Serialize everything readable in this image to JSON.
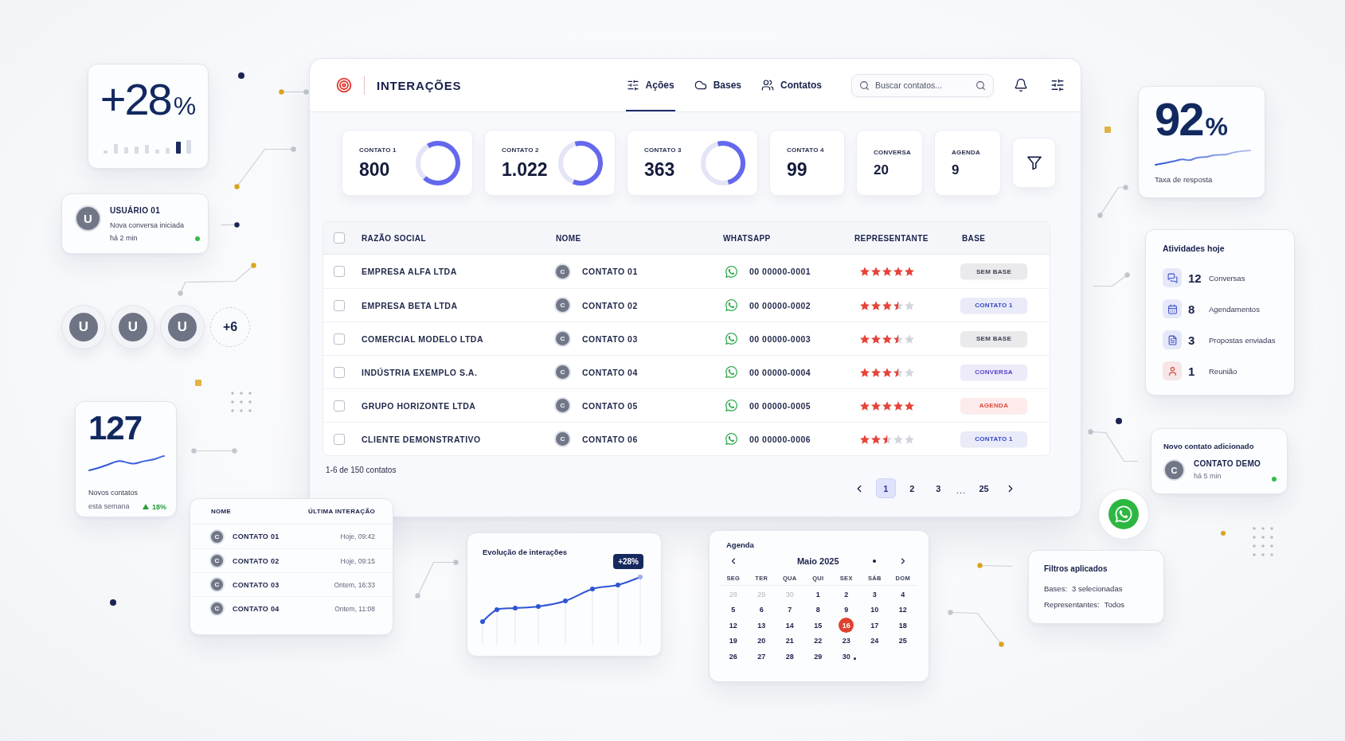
{
  "growth_card": {
    "value": "+28",
    "unit": "%"
  },
  "user_card": {
    "avatar": "U",
    "name": "USUÁRIO 01",
    "message": "Nova conversa iniciada",
    "time": "há 2 min",
    "online": true
  },
  "avatar_group": {
    "avatars": [
      "U",
      "U",
      "U"
    ],
    "more": "+6"
  },
  "new_contacts_card": {
    "value": "127",
    "label": "Novos contatos",
    "period": "esta semana",
    "change": "18%"
  },
  "header": {
    "title": "INTERAÇÕES",
    "tabs": [
      {
        "label": "Ações",
        "selected": true
      },
      {
        "label": "Bases",
        "selected": false
      },
      {
        "label": "Contatos",
        "selected": false
      }
    ],
    "search": {
      "placeholder": "Buscar contatos..."
    }
  },
  "stats": [
    {
      "kind": "ring",
      "label": "CONTATO 1",
      "value": "800",
      "level": 0.7
    },
    {
      "kind": "ring",
      "label": "CONTATO 2",
      "value": "1.022",
      "level": 0.6
    },
    {
      "kind": "ring",
      "label": "CONTATO 3",
      "value": "363",
      "level": 0.5
    },
    {
      "kind": "number",
      "label": "CONTATO 4",
      "value": "99"
    },
    {
      "kind": "compact",
      "label": "CONVERSA",
      "value": "20"
    },
    {
      "kind": "compact",
      "label": "AGENDA",
      "value": "9"
    }
  ],
  "table": {
    "all_checked": false,
    "columns": [
      "RAZÃO SOCIAL",
      "NOME",
      "WHATSAPP",
      "REPRESENTANTE",
      "BASE"
    ],
    "rows": [
      {
        "checked": false,
        "company": "EMPRESA ALFA LTDA",
        "avatar": "C",
        "contact": "CONTATO 01",
        "whatsapp": "00 00000-0001",
        "stars": 5,
        "base": {
          "label": "SEM BASE",
          "color": "#3d4254"
        }
      },
      {
        "checked": false,
        "company": "EMPRESA BETA LTDA",
        "avatar": "C",
        "contact": "CONTATO 02",
        "whatsapp": "00 00000-0002",
        "stars": 3.5,
        "base": {
          "label": "CONTATO 1",
          "color": "#3346c8"
        }
      },
      {
        "checked": false,
        "company": "COMERCIAL MODELO LTDA",
        "avatar": "C",
        "contact": "CONTATO 03",
        "whatsapp": "00 00000-0003",
        "stars": 3.5,
        "base": {
          "label": "SEM BASE",
          "color": "#3d4254"
        }
      },
      {
        "checked": false,
        "company": "INDÚSTRIA EXEMPLO S.A.",
        "avatar": "C",
        "contact": "CONTATO 04",
        "whatsapp": "00 00000-0004",
        "stars": 3.5,
        "base": {
          "label": "CONVERSA",
          "color": "#5a3fc8"
        }
      },
      {
        "checked": false,
        "company": "GRUPO HORIZONTE LTDA",
        "avatar": "C",
        "contact": "CONTATO 05",
        "whatsapp": "00 00000-0005",
        "stars": 5,
        "base": {
          "label": "AGENDA",
          "color": "#e0493d"
        }
      },
      {
        "checked": false,
        "company": "CLIENTE DEMONSTRATIVO",
        "avatar": "C",
        "contact": "CONTATO 06",
        "whatsapp": "00 00000-0006",
        "stars": 2.5,
        "base": {
          "label": "CONTATO 1",
          "color": "#3346c8"
        }
      }
    ]
  },
  "footer": {
    "summary": "1-6 de 150 contatos",
    "pages": [
      {
        "kind": "page",
        "label": "1",
        "selected": true
      },
      {
        "kind": "page",
        "label": "2",
        "selected": false
      },
      {
        "kind": "page",
        "label": "3",
        "selected": false
      },
      {
        "kind": "ellipsis",
        "label": "...",
        "selected": false
      },
      {
        "kind": "page",
        "label": "25",
        "selected": false
      }
    ]
  },
  "rate_card": {
    "value": "92",
    "unit": "%",
    "label": "Taxa de resposta"
  },
  "activities": {
    "title": "Atividades hoje",
    "items": [
      {
        "count": "12",
        "label": "Conversas",
        "color": "#3f51c9"
      },
      {
        "count": "8",
        "label": "Agendamentos",
        "color": "#3f51c9"
      },
      {
        "count": "3",
        "label": "Propostas enviadas",
        "color": "#3f51c9"
      },
      {
        "count": "1",
        "label": "Reunião",
        "color": "#d9453b"
      }
    ]
  },
  "new_contact_card": {
    "title": "Novo contato adicionado",
    "avatar": "C",
    "name": "CONTATO DEMO",
    "time": "há 5 min",
    "online": true
  },
  "recent_table": {
    "columns": [
      "NOME",
      "ÚLTIMA INTERAÇÃO"
    ],
    "rows": [
      {
        "avatar": "C",
        "name": "CONTATO 01",
        "time": "Hoje, 09:42"
      },
      {
        "avatar": "C",
        "name": "CONTATO 02",
        "time": "Hoje, 09:15"
      },
      {
        "avatar": "C",
        "name": "CONTATO 03",
        "time": "Ontem, 16:33"
      },
      {
        "avatar": "C",
        "name": "CONTATO 04",
        "time": "Ontem, 11:08"
      }
    ]
  },
  "evolution_chart": {
    "title": "Evolução de interações",
    "badge": "+28%"
  },
  "calendar": {
    "title": "Agenda",
    "month": "Maio 2025",
    "weekdays": [
      "SEG",
      "TER",
      "QUA",
      "QUI",
      "SEX",
      "SÁB",
      "DOM"
    ],
    "days": [
      {
        "label": "28",
        "muted": true,
        "selected": false,
        "event": false
      },
      {
        "label": "29",
        "muted": true,
        "selected": false,
        "event": false
      },
      {
        "label": "30",
        "muted": true,
        "selected": false,
        "event": false
      },
      {
        "label": "1",
        "muted": false,
        "selected": false,
        "event": false
      },
      {
        "label": "2",
        "muted": false,
        "selected": false,
        "event": false
      },
      {
        "label": "3",
        "muted": false,
        "selected": false,
        "event": false
      },
      {
        "label": "4",
        "muted": false,
        "selected": false,
        "event": false
      },
      {
        "label": "5",
        "muted": false,
        "selected": false,
        "event": false
      },
      {
        "label": "6",
        "muted": false,
        "selected": false,
        "event": false
      },
      {
        "label": "7",
        "muted": false,
        "selected": false,
        "event": false
      },
      {
        "label": "8",
        "muted": false,
        "selected": false,
        "event": false
      },
      {
        "label": "9",
        "muted": false,
        "selected": false,
        "event": false
      },
      {
        "label": "10",
        "muted": false,
        "selected": false,
        "event": false
      },
      {
        "label": "12",
        "muted": false,
        "selected": false,
        "event": false
      },
      {
        "label": "12",
        "muted": false,
        "selected": false,
        "event": false
      },
      {
        "label": "13",
        "muted": false,
        "selected": false,
        "event": false
      },
      {
        "label": "14",
        "muted": false,
        "selected": false,
        "event": false
      },
      {
        "label": "15",
        "muted": false,
        "selected": false,
        "event": false
      },
      {
        "label": "16",
        "muted": false,
        "selected": true,
        "event": false
      },
      {
        "label": "17",
        "muted": false,
        "selected": false,
        "event": false
      },
      {
        "label": "18",
        "muted": false,
        "selected": false,
        "event": false
      },
      {
        "label": "19",
        "muted": false,
        "selected": false,
        "event": false
      },
      {
        "label": "20",
        "muted": false,
        "selected": false,
        "event": false
      },
      {
        "label": "21",
        "muted": false,
        "selected": false,
        "event": false
      },
      {
        "label": "22",
        "muted": false,
        "selected": false,
        "event": false
      },
      {
        "label": "23",
        "muted": false,
        "selected": false,
        "event": false
      },
      {
        "label": "24",
        "muted": false,
        "selected": false,
        "event": false
      },
      {
        "label": "25",
        "muted": false,
        "selected": false,
        "event": false
      },
      {
        "label": "26",
        "muted": false,
        "selected": false,
        "event": false
      },
      {
        "label": "27",
        "muted": false,
        "selected": false,
        "event": false
      },
      {
        "label": "28",
        "muted": false,
        "selected": false,
        "event": false
      },
      {
        "label": "29",
        "muted": false,
        "selected": false,
        "event": false
      },
      {
        "label": "30",
        "muted": false,
        "selected": false,
        "event": true
      }
    ]
  },
  "filters_card": {
    "title": "Filtros aplicados",
    "rows": [
      {
        "label": "Bases:",
        "value": "3 selecionadas"
      },
      {
        "label": "Representantes:",
        "value": "Todos"
      }
    ]
  }
}
